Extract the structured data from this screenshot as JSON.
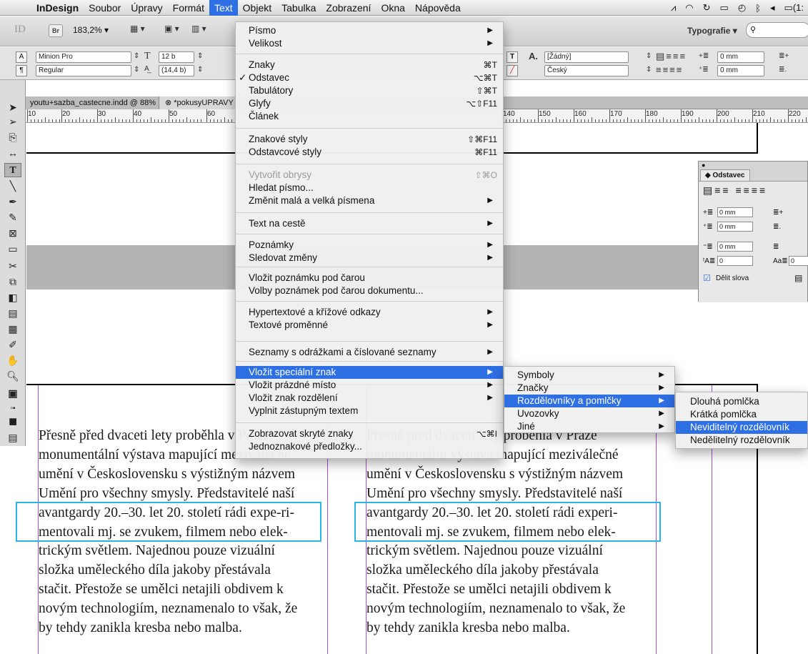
{
  "menubar": {
    "app": "InDesign",
    "items": [
      "Soubor",
      "Úpravy",
      "Formát",
      "Text",
      "Objekt",
      "Tabulka",
      "Zobrazení",
      "Okna",
      "Nápověda"
    ],
    "active": "Text",
    "time": "(1:"
  },
  "appbar": {
    "logo": "ID",
    "bridge": "Br",
    "zoom": "183,2% ▾",
    "workspace": "Typografie ▾"
  },
  "control": {
    "font": "Minion Pro",
    "style": "Regular",
    "size": "12 b",
    "leading": "(14,4 b)",
    "char_style": "[Žádný]",
    "language": "Český",
    "indent1": "0 mm",
    "indent2": "0 mm"
  },
  "doc": {
    "tab1": "youtu+sazba_castecne.indd @ 88%",
    "tab2": "*pokusyUPRAVY",
    "ruler": [
      "10",
      "20",
      "30",
      "40",
      "50",
      "60",
      "140",
      "150",
      "160",
      "170",
      "180",
      "190",
      "200",
      "210",
      "220"
    ]
  },
  "menu": {
    "items": [
      {
        "label": "Písmo",
        "arrow": true
      },
      {
        "label": "Velikost",
        "arrow": true
      },
      {
        "label": "Znaky",
        "sc": "⌘T"
      },
      {
        "label": "Odstavec",
        "sc": "⌥⌘T",
        "check": true
      },
      {
        "label": "Tabulátory",
        "sc": "⇧⌘T"
      },
      {
        "label": "Glyfy",
        "sc": "⌥⇧F11"
      },
      {
        "label": "Článek"
      },
      {
        "label": "Znakové styly",
        "sc": "⇧⌘F11"
      },
      {
        "label": "Odstavcové styly",
        "sc": "⌘F11"
      },
      {
        "label": "Vytvořit obrysy",
        "sc": "⇧⌘O",
        "disabled": true
      },
      {
        "label": "Hledat písmo..."
      },
      {
        "label": "Změnit malá a velká písmena",
        "arrow": true
      },
      {
        "label": "Text na cestě",
        "arrow": true
      },
      {
        "label": "Poznámky",
        "arrow": true
      },
      {
        "label": "Sledovat změny",
        "arrow": true
      },
      {
        "label": "Vložit poznámku pod čarou"
      },
      {
        "label": "Volby poznámek pod čarou dokumentu..."
      },
      {
        "label": "Hypertextové a křížové odkazy",
        "arrow": true
      },
      {
        "label": "Textové proměnné",
        "arrow": true
      },
      {
        "label": "Seznamy s odrážkami a číslované seznamy",
        "arrow": true
      },
      {
        "label": "Vložit speciální znak",
        "arrow": true,
        "highlight": true
      },
      {
        "label": "Vložit prázdné místo",
        "arrow": true
      },
      {
        "label": "Vložit znak rozdělení",
        "arrow": true
      },
      {
        "label": "Vyplnit zástupným textem"
      },
      {
        "label": "Zobrazovat skryté znaky",
        "sc": "⌥⌘I"
      },
      {
        "label": "Jednoznakové předložky..."
      }
    ]
  },
  "submenu1": {
    "items": [
      "Symboly",
      "Značky",
      "Rozdělovníky a pomlčky",
      "Uvozovky",
      "Jiné"
    ],
    "highlight": "Rozdělovníky a pomlčky"
  },
  "submenu2": {
    "items": [
      "Dlouhá pomlčka",
      "Krátká pomlčka",
      "Neviditelný rozdělovník",
      "Nedělitelný rozdělovník"
    ],
    "highlight": "Neviditelný rozdělovník"
  },
  "panel": {
    "title": "Odstavec",
    "checkbox": "Dělit slova",
    "v1": "0 mm",
    "v2": "0 mm",
    "v3": "0 mm",
    "v4": "0",
    "v5": "0"
  },
  "left_col": [
    "Přesně před dvaceti lety proběhla v Praze",
    "monumentální výstava mapující meziválečné",
    "umění v Československu s výstižným názvem",
    "Umění pro všechny smysly. Představitelé naší",
    "avantgardy 20.–30. let 20. století rádi expe-ri-",
    "mentovali mj. se zvukem, filmem nebo elek-",
    "trickým světlem. Najednou pouze vizuální",
    "složka uměleckého díla jakoby přestávala",
    "stačit. Přestože se umělci netajili obdivem k",
    "novým technologiím, neznamenalo to však, že",
    "by tehdy zanikla kresba nebo malba."
  ],
  "right_col": [
    "Přesně před dvaceti lety proběhla v Praze",
    "monumentální výstava mapující meziválečné",
    "umění v Československu s výstižným názvem",
    "Umění pro všechny smysly. Představitelé naší",
    "avantgardy 20.–30. let 20. století rádi experi-",
    "mentovali mj. se zvukem, filmem nebo elek-",
    "trickým světlem. Najednou pouze vizuální",
    "složka uměleckého díla jakoby přestávala",
    "stačit. Přestože se umělci netajili obdivem k",
    "novým technologiím, neznamenalo to však, že",
    "by tehdy zanikla kresba nebo malba."
  ]
}
